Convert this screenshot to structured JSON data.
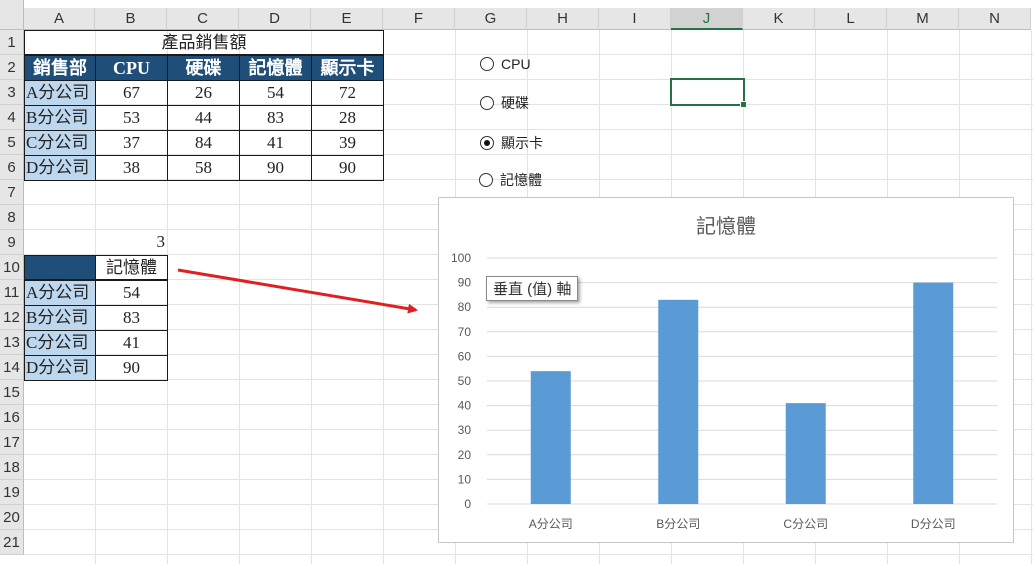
{
  "columns": [
    "A",
    "B",
    "C",
    "D",
    "E",
    "F",
    "G",
    "H",
    "I",
    "J",
    "K",
    "L",
    "M",
    "N"
  ],
  "rows": [
    "1",
    "2",
    "3",
    "4",
    "5",
    "6",
    "7",
    "8",
    "9",
    "10",
    "11",
    "12",
    "13",
    "14",
    "15",
    "16",
    "17",
    "18",
    "19",
    "20",
    "21"
  ],
  "selected_column": "J",
  "sales_table": {
    "title": "產品銷售額",
    "headers": [
      "銷售部",
      "CPU",
      "硬碟",
      "記憶體",
      "顯示卡"
    ],
    "rows": [
      {
        "dept": "A分公司",
        "values": [
          "67",
          "26",
          "54",
          "72"
        ]
      },
      {
        "dept": "B分公司",
        "values": [
          "53",
          "44",
          "83",
          "28"
        ]
      },
      {
        "dept": "C分公司",
        "values": [
          "37",
          "84",
          "41",
          "39"
        ]
      },
      {
        "dept": "D分公司",
        "values": [
          "38",
          "58",
          "90",
          "90"
        ]
      }
    ]
  },
  "lookup": {
    "index": "3",
    "header": "記憶體",
    "rows": [
      {
        "dept": "A分公司",
        "value": "54"
      },
      {
        "dept": "B分公司",
        "value": "83"
      },
      {
        "dept": "C分公司",
        "value": "41"
      },
      {
        "dept": "D分公司",
        "value": "90"
      }
    ]
  },
  "options": [
    {
      "label": "CPU",
      "selected": false
    },
    {
      "label": "硬碟",
      "selected": false
    },
    {
      "label": "顯示卡",
      "selected": true
    },
    {
      "label": "記憶體",
      "selected": false
    }
  ],
  "tooltip": "垂直 (值) 軸",
  "colors": {
    "header_fill": "#1f4e79",
    "dept_fill": "#bdd7ee",
    "bar": "#5b9bd5",
    "arrow": "#e02020",
    "selection": "#217346"
  },
  "chart_data": {
    "type": "bar",
    "title": "記憶體",
    "categories": [
      "A分公司",
      "B分公司",
      "C分公司",
      "D分公司"
    ],
    "series": [
      {
        "values": [
          54,
          83,
          41,
          90
        ]
      }
    ],
    "ylim": [
      0,
      100
    ],
    "yticks": [
      0,
      10,
      20,
      30,
      40,
      50,
      60,
      70,
      80,
      90,
      100
    ],
    "grid": true,
    "legend": "none"
  }
}
